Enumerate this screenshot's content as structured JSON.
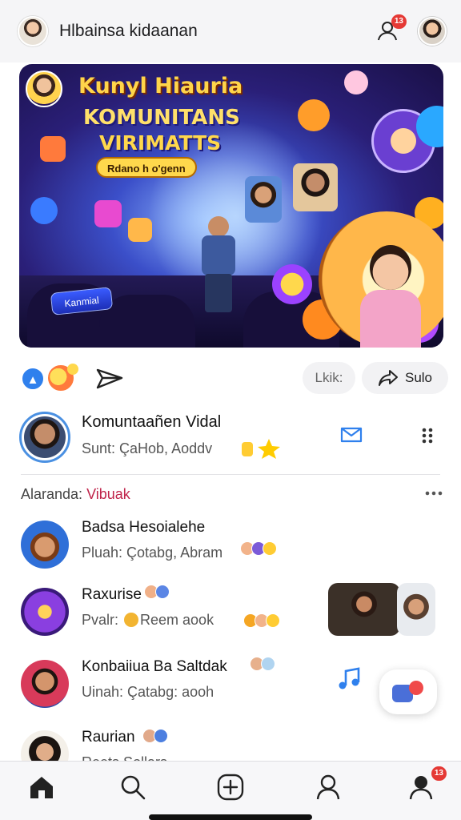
{
  "header": {
    "title": "Hlbainsa kidaanan",
    "notification_count": "13",
    "icons": {
      "notifications": "person-bell-icon",
      "profile": "profile-avatar"
    }
  },
  "banner": {
    "title_line1": "Kunyl Hiauria",
    "title_line2": "KOMUNITANS",
    "title_line3": "VIRIMATTS",
    "pill_text": "Rdano h o'genn",
    "tag_text": "Kanmial"
  },
  "actions": {
    "like_label": "Lkik:",
    "share_label": "Sulo",
    "icons": {
      "like": "thumbs-up-icon",
      "emoji": "emoji-reaction-icon",
      "send": "send-icon",
      "share": "share-arrow-icon"
    }
  },
  "featured": {
    "name": "Komuntaañen Vidal",
    "subtitle": "Sunt: ÇaHob, Aoddv"
  },
  "section": {
    "label": "Alaranda: ",
    "label_accent": "Vibuak"
  },
  "list": [
    {
      "name": "Badsa Hesoialehe",
      "subtitle": "Pluah: Çotabg, Abram"
    },
    {
      "name": "Raxurise",
      "subtitle": "Pvalr: ",
      "subtitle_tail": "Reem aook"
    },
    {
      "name": "Konbaiiua Ba Saltdak",
      "subtitle": "Uinah: Çatabg: aooh"
    },
    {
      "name": "Raurian",
      "subtitle": "Reets Sollars"
    }
  ],
  "bottom_nav": {
    "items": [
      "home-icon",
      "search-icon",
      "add-icon",
      "profile-icon",
      "account-icon"
    ],
    "account_badge": "13"
  },
  "colors": {
    "accent_blue": "#2f80ed",
    "badge_red": "#e53935",
    "section_accent": "#c0254b"
  }
}
